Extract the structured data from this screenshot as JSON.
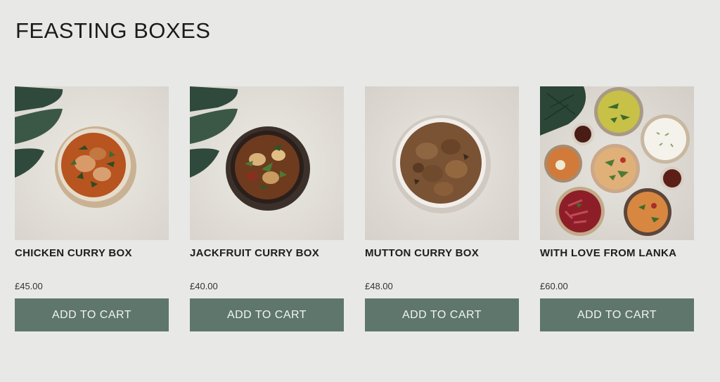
{
  "page": {
    "title": "FEASTING BOXES"
  },
  "products": [
    {
      "name": "CHICKEN CURRY BOX",
      "price": "£45.00",
      "button_label": "ADD TO CART",
      "image": "chicken-curry-bowl"
    },
    {
      "name": "JACKFRUIT CURRY BOX",
      "price": "£40.00",
      "button_label": "ADD TO CART",
      "image": "jackfruit-curry-bowl"
    },
    {
      "name": "MUTTON CURRY BOX",
      "price": "£48.00",
      "button_label": "ADD TO CART",
      "image": "mutton-curry-bowl"
    },
    {
      "name": "WITH LOVE FROM LANKA",
      "price": "£60.00",
      "button_label": "ADD TO CART",
      "image": "lanka-feast-spread"
    }
  ],
  "colors": {
    "background": "#e8e9e6",
    "button": "#5f766c",
    "button_text": "#f2f4f2",
    "heading": "#1b1b1b"
  }
}
